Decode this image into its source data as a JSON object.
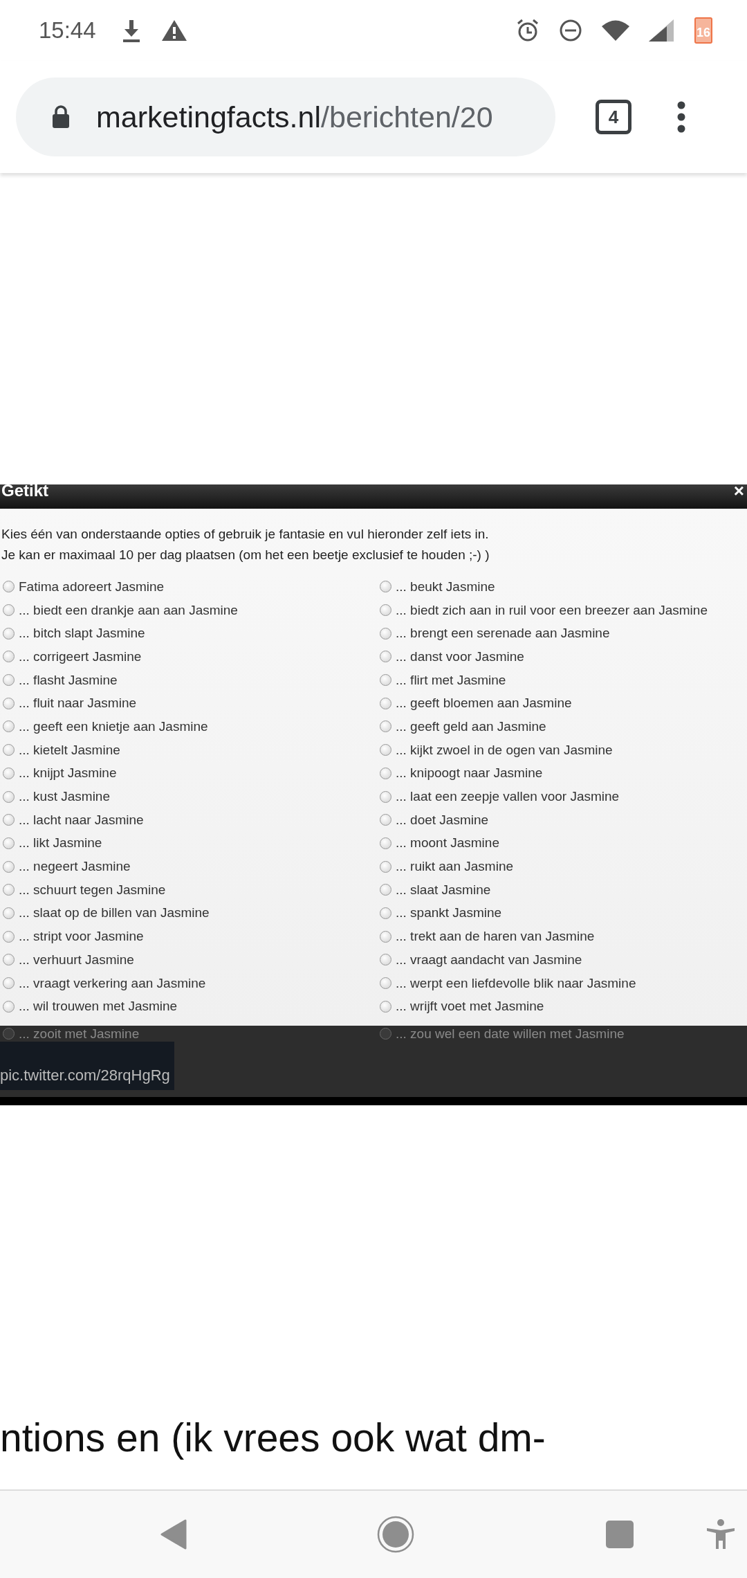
{
  "status_bar": {
    "time": "15:44",
    "battery": "16"
  },
  "toolbar": {
    "url_domain": "marketingfacts.nl",
    "url_path": "/berichten/20",
    "tab_count": "4"
  },
  "embedded_image": {
    "title": "Getikt",
    "close": "×",
    "intro": [
      "Kies één van onderstaande opties of gebruik je fantasie en vul hieronder zelf iets in.",
      "Je kan er maximaal 10 per dag plaatsen (om het een beetje exclusief te houden ;-) )"
    ],
    "options": [
      {
        "label": "Fatima adoreert Jasmine",
        "selected": false
      },
      {
        "label": "... beukt Jasmine",
        "selected": false
      },
      {
        "label": "... biedt een drankje aan aan Jasmine",
        "selected": false
      },
      {
        "label": "... biedt zich aan in ruil voor een breezer aan Jasmine",
        "selected": false
      },
      {
        "label": "... bitch slapt Jasmine",
        "selected": false
      },
      {
        "label": "... brengt een serenade aan Jasmine",
        "selected": false
      },
      {
        "label": "... corrigeert Jasmine",
        "selected": false
      },
      {
        "label": "... danst voor Jasmine",
        "selected": false
      },
      {
        "label": "... flasht Jasmine",
        "selected": false
      },
      {
        "label": "... flirt met Jasmine",
        "selected": false
      },
      {
        "label": "... fluit naar Jasmine",
        "selected": false
      },
      {
        "label": "... geeft bloemen aan Jasmine",
        "selected": false
      },
      {
        "label": "... geeft een knietje aan Jasmine",
        "selected": false
      },
      {
        "label": "... geeft geld aan Jasmine",
        "selected": false
      },
      {
        "label": "... kietelt Jasmine",
        "selected": false
      },
      {
        "label": "... kijkt zwoel in de ogen van Jasmine",
        "selected": false
      },
      {
        "label": "... knijpt Jasmine",
        "selected": false
      },
      {
        "label": "... knipoogt naar Jasmine",
        "selected": false
      },
      {
        "label": "... kust Jasmine",
        "selected": false
      },
      {
        "label": "... laat een zeepje vallen voor Jasmine",
        "selected": false
      },
      {
        "label": "... lacht naar Jasmine",
        "selected": false
      },
      {
        "label": "... doet Jasmine",
        "selected": false
      },
      {
        "label": "... likt Jasmine",
        "selected": false
      },
      {
        "label": "... moont Jasmine",
        "selected": false
      },
      {
        "label": "... negeert Jasmine",
        "selected": false
      },
      {
        "label": "... ruikt aan Jasmine",
        "selected": false
      },
      {
        "label": "... schuurt tegen Jasmine",
        "selected": false
      },
      {
        "label": "... slaat Jasmine",
        "selected": false
      },
      {
        "label": "... slaat op de billen van Jasmine",
        "selected": false
      },
      {
        "label": "... spankt Jasmine",
        "selected": false
      },
      {
        "label": "... stript voor Jasmine",
        "selected": false
      },
      {
        "label": "... trekt aan de haren van Jasmine",
        "selected": false
      },
      {
        "label": "... verhuurt Jasmine",
        "selected": false
      },
      {
        "label": "... vraagt aandacht van Jasmine",
        "selected": false
      },
      {
        "label": "... vraagt verkering aan Jasmine",
        "selected": false
      },
      {
        "label": "... werpt een liefdevolle blik naar Jasmine",
        "selected": false
      },
      {
        "label": "... wil trouwen met Jasmine",
        "selected": false
      },
      {
        "label": "... wrijft voet met Jasmine",
        "selected": false
      }
    ],
    "footer": {
      "options": [
        {
          "label": "... zooit met Jasmine",
          "selected": false
        },
        {
          "label": "... zou wel een date willen met Jasmine",
          "selected": false
        }
      ],
      "caption": "pic.twitter.com/28rqHgRg"
    }
  },
  "article_text": "ntions en (ik vrees ook wat dm-"
}
